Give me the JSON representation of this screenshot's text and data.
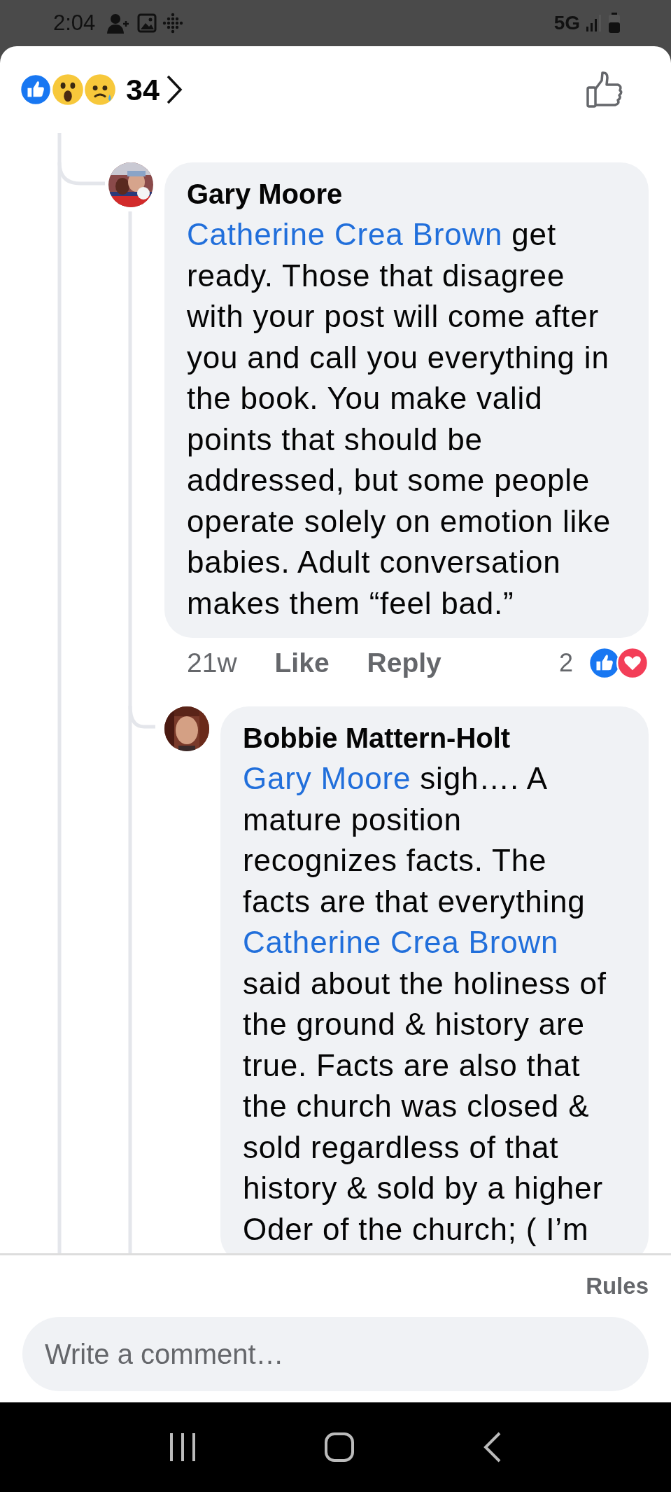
{
  "status_bar": {
    "time": "2:04",
    "network": "5G"
  },
  "reactions_header": {
    "reactions": [
      {
        "kind": "like"
      },
      {
        "kind": "wow"
      },
      {
        "kind": "sad"
      }
    ],
    "count": "34"
  },
  "comments": [
    {
      "author": "Gary Moore",
      "body": [
        {
          "kind": "mention",
          "text": "Catherine Crea Brown"
        },
        {
          "kind": "text",
          "text": " get ready. Those that disagree with your post will come after you and call you everything in the book. You make valid points that should be addressed, but some people operate solely on emotion like babies. Adult conversation makes them “feel bad.”"
        }
      ],
      "time": "21w",
      "actions": [
        "Like",
        "Reply"
      ],
      "reaction_count": "2",
      "reactions": [
        {
          "kind": "like"
        },
        {
          "kind": "love"
        }
      ]
    },
    {
      "author": "Bobbie Mattern-Holt",
      "body": [
        {
          "kind": "mention",
          "text": "Gary Moore"
        },
        {
          "kind": "text",
          "text": " sigh…. A mature position recognizes facts. The facts are that everything "
        },
        {
          "kind": "mention",
          "text": "Catherine Crea Brown"
        },
        {
          "kind": "text",
          "text": " said about the holiness of the ground & history are true. Facts are also that the church was closed & sold regardless of that history & sold by a higher Oder of the church; ( I’m"
        }
      ]
    }
  ],
  "composer": {
    "rules": "Rules",
    "placeholder": "Write a comment…"
  }
}
